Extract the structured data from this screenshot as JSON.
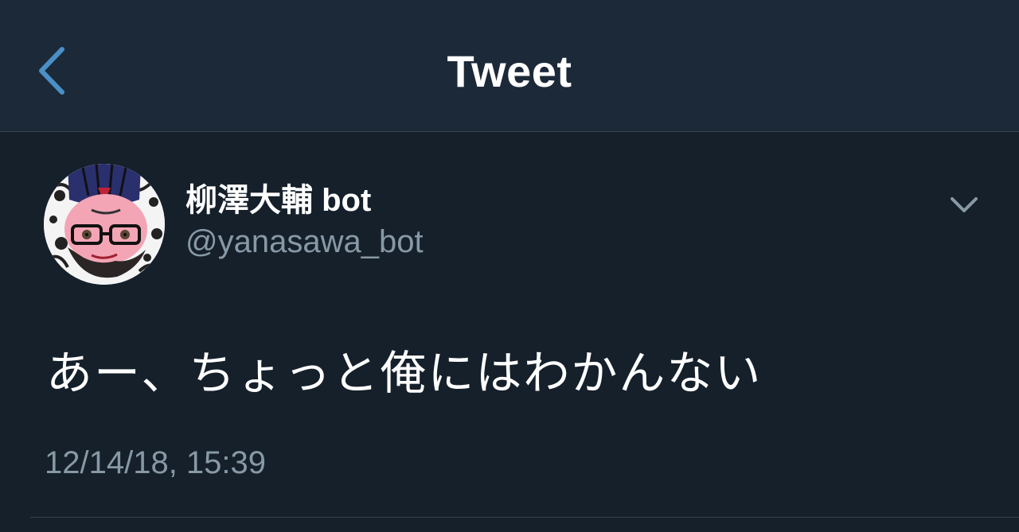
{
  "header": {
    "title": "Tweet",
    "back_icon": "chevron-left-icon"
  },
  "tweet": {
    "author": {
      "display_name": "柳澤大輔 bot",
      "handle": "@yanasawa_bot"
    },
    "text": "あー、ちょっと俺にはわかんない",
    "timestamp": "12/14/18, 15:39",
    "menu_icon": "chevron-down-icon"
  },
  "colors": {
    "background": "#15202b",
    "header_background": "#1c2938",
    "accent": "#4a90c8",
    "secondary_text": "#8899a6",
    "divider": "#38444d"
  }
}
